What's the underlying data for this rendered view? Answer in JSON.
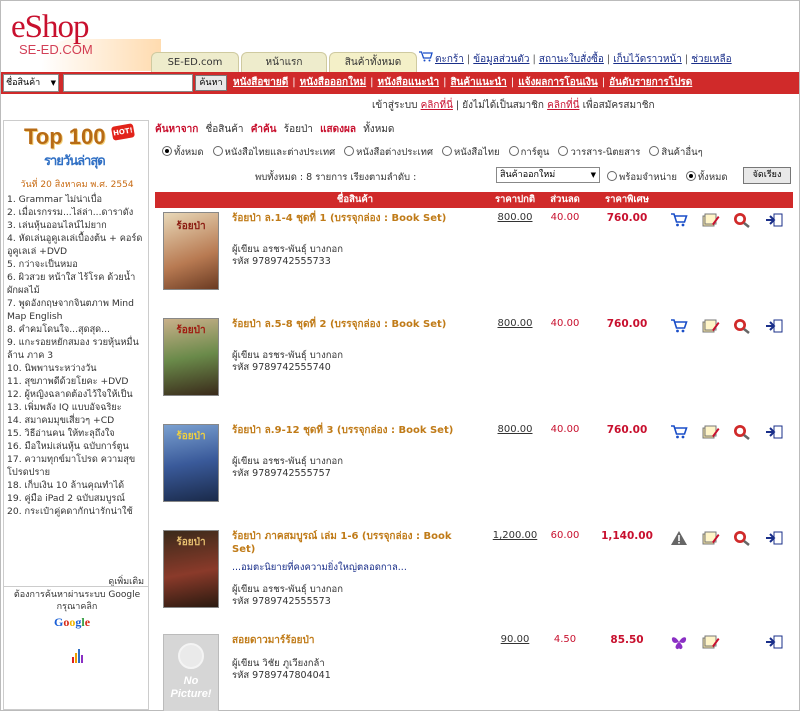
{
  "brand": {
    "name": "eShop",
    "sub": "SE-ED.COM"
  },
  "tabs": [
    {
      "label": "SE-ED.com"
    },
    {
      "label": "หน้าแรก"
    },
    {
      "label": "สินค้าทั้งหมด"
    }
  ],
  "top_links": {
    "cart": "ตะกร้า",
    "account": "ข้อมูลส่วนตัว",
    "order_status": "สถานะใบสั่งซื้อ",
    "wishlist": "เก็บไว้ดราวหน้า",
    "help": "ช่วยเหลือ"
  },
  "search": {
    "category": "ชื่อสินค้า",
    "button": "ค้นหา",
    "value": ""
  },
  "nav": {
    "items": [
      "หนังสือขายดี",
      "หนังสือออกใหม่",
      "หนังสือแนะนำ",
      "สินค้าแนะนำ",
      "แจ้งผลการโอนเงิน",
      "อันดับรายการโปรด"
    ]
  },
  "member": {
    "login_prefix": "เข้าสู่ระบบ",
    "login_link": "คลิกที่นี่",
    "register_prefix": "ยังไม่ได้เป็นสมาชิก",
    "register_link": "คลิกที่นี่",
    "register_suffix": "เพื่อสมัครสมาชิก"
  },
  "sidebar": {
    "top_title": "Top 100",
    "hot": "HOT!",
    "subtitle": "รายวันล่าสุด",
    "date": "วันที่ 20 สิงหาคม พ.ศ. 2554",
    "items": [
      "1. Grammar ไม่น่าเบื่อ",
      "2. เมื่อเรกรรม...ไล่ล่า...ดาราดัง",
      "3. เล่นหุ้นออนไลน์ไม่ยาก",
      "4. หัดเล่นอูคูเลเล่เบื้องต้น + คอร์ดอูคูเลเล่ +DVD",
      "5. กว่าจะเป็นหมอ",
      "6. ผิวสวย หน้าใส ไร้โรค ด้วยน้ำผักผลไม้",
      "7. พูดอังกฤษจากจินตภาพ Mind Map English",
      "8. คำคมโดนใจ...สุดสุด...",
      "9. แกะรอยหยักสมอง รวยหุ้นหมื่นล้าน ภาค 3",
      "10. นิพพานระหว่างวัน",
      "11. สุขภาพดีด้วยโยคะ +DVD",
      "12. ผู้หญิงฉลาดต้องไว้ใจให้เป็น",
      "13. เพิ่มพลัง IQ แบบอัจฉริยะ",
      "14. สมาคมมุขเสี่ยวๆ +CD",
      "15. วิธีอ่านคน ให้ทะลุถึงใจ",
      "16. มือใหม่เล่นหุ้น ฉบับการ์ตูน",
      "17. ความทุกข์มาโปรด ความสุขโปรดปราย",
      "18. เก็บเงิน 10 ล้านคุณทำได้",
      "19. คู่มือ iPad 2 ฉบับสมบูรณ์",
      "20. กระเป๋าคู่คดากักน่ารักน่าใช้"
    ],
    "more": "ดูเพิ่มเติม",
    "google_text": "ต้องการค้นหาผ่านระบบ Google กรุณาคลิก",
    "google": "Google"
  },
  "main": {
    "search_by_label": "ค้นหาจาก",
    "search_by_value": "ชื่อสินค้า",
    "keyword_label": "คำค้น",
    "keyword_value": "ร้อยป่า",
    "show_label": "แสดงผล",
    "show_value": "ทั้งหมด",
    "category_radios": [
      "ทั้งหมด",
      "หนังสือไทยและต่างประเทศ",
      "หนังสือต่างประเทศ",
      "หนังสือไทย",
      "การ์ตูน",
      "วารสาร-นิตยสาร",
      "สินค้าอื่นๆ"
    ],
    "results_text": "พบทั้งหมด : 8 รายการ เรียงตามลำดับ :",
    "sort_value": "สินค้าออกใหม่",
    "availability_radios": [
      "พร้อมจำหน่าย",
      "ทั้งหมด"
    ],
    "sort_button": "จัดเรียง",
    "columns": {
      "name": "ชื่อสินค้า",
      "price": "ราคาปกติ",
      "discount": "ส่วนลด",
      "special": "ราคาพิเศษ"
    }
  },
  "products": [
    {
      "title": "ร้อยป่า ล.1-4 ชุดที่ 1 (บรรจุกล่อง : Book Set)",
      "desc": "",
      "author": "ผู้เขียน อรชร-พันธุ์ บางกอก",
      "isbn": "รหัส 9789742555733",
      "price": "800.00",
      "discount": "40.00",
      "special": "760.00",
      "cover_text": "ร้อยป่า"
    },
    {
      "title": "ร้อยป่า ล.5-8 ชุดที่ 2 (บรรจุกล่อง : Book Set)",
      "desc": "",
      "author": "ผู้เขียน อรชร-พันธุ์ บางกอก",
      "isbn": "รหัส 9789742555740",
      "price": "800.00",
      "discount": "40.00",
      "special": "760.00",
      "cover_text": "ร้อยป่า"
    },
    {
      "title": "ร้อยป่า ล.9-12 ชุดที่ 3 (บรรจุกล่อง : Book Set)",
      "desc": "",
      "author": "ผู้เขียน อรชร-พันธุ์ บางกอก",
      "isbn": "รหัส 9789742555757",
      "price": "800.00",
      "discount": "40.00",
      "special": "760.00",
      "cover_text": "ร้อยป่า"
    },
    {
      "title": "ร้อยป่า ภาคสมบูรณ์ เล่ม 1-6 (บรรจุกล่อง : Book Set)",
      "desc": "...อมตะนิยายที่คงความยิ่งใหญ่ตลอดกาล...",
      "author": "ผู้เขียน อรชร-พันธุ์ บางกอก",
      "isbn": "รหัส 9789742555573",
      "price": "1,200.00",
      "discount": "60.00",
      "special": "1,140.00",
      "cover_text": "ร้อยป่า"
    },
    {
      "title": "สอยดาวมาร์ร้อยป่า",
      "desc": "",
      "author": "ผู้เขียน วิชัย ภูเวียงกล้า",
      "isbn": "รหัส 9789747804041",
      "price": "90.00",
      "discount": "4.50",
      "special": "85.50",
      "no_picture": "No Picture!"
    }
  ],
  "colors": {
    "accent_red": "#d02a2a",
    "title_orange": "#c07b18",
    "link_blue": "#1a2f8a"
  }
}
